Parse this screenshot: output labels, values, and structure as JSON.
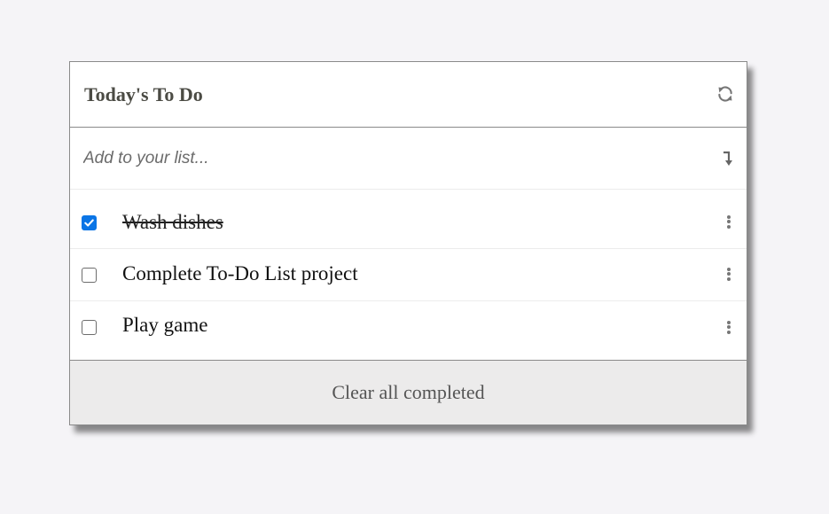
{
  "app": {
    "title": "Today's To Do"
  },
  "add": {
    "placeholder": "Add to your list..."
  },
  "items": [
    {
      "label": "Wash dishes",
      "completed": true
    },
    {
      "label": "Complete To-Do List project",
      "completed": false
    },
    {
      "label": "Play game",
      "completed": false
    }
  ],
  "footer": {
    "clear_label": "Clear all completed"
  },
  "colors": {
    "accent": "#0b75e6",
    "background": "#f5f4f7",
    "footer_bg": "#ecebeb"
  },
  "icons": {
    "refresh": "refresh-icon",
    "enter": "enter-arrow-icon",
    "more": "kebab-menu-icon"
  }
}
